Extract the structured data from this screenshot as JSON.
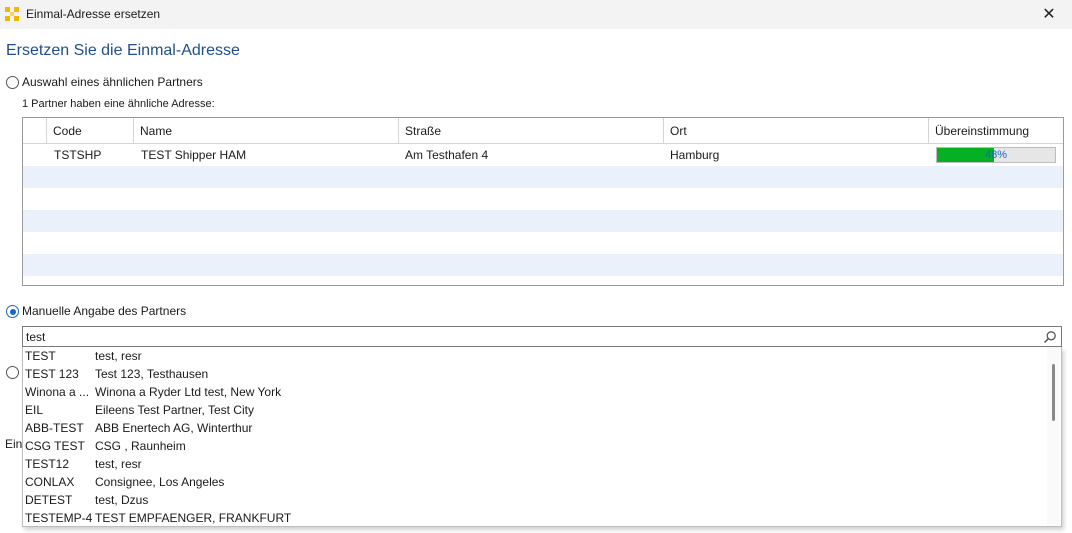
{
  "window": {
    "title": "Einmal-Adresse ersetzen",
    "close_glyph": "✕"
  },
  "heading": "Ersetzen Sie die Einmal-Adresse",
  "option_similar": {
    "label": "Auswahl eines ähnlichen Partners",
    "sub_label": "1 Partner haben eine ähnliche Adresse:",
    "columns": [
      "Code",
      "Name",
      "Straße",
      "Ort",
      "Übereinstimmung"
    ],
    "rows": [
      {
        "code": "TSTSHP",
        "name": "TEST Shipper HAM",
        "street": "Am Testhafen 4",
        "city": "Hamburg",
        "match_text": "48%",
        "match_value": 0.48
      }
    ]
  },
  "option_manual": {
    "label": "Manuelle Angabe des Partners",
    "search_value": "test",
    "search_icon": "magnifier-icon",
    "suggestions": [
      {
        "code": "TEST",
        "desc": "test, resr"
      },
      {
        "code": "TEST 123",
        "desc": "Test 123, Testhausen"
      },
      {
        "code": "Winona a ...",
        "desc": "Winona a Ryder Ltd test, New York"
      },
      {
        "code": "EIL",
        "desc": "Eileens Test Partner, Test City"
      },
      {
        "code": "ABB-TEST",
        "desc": "ABB Enertech AG, Winterthur"
      },
      {
        "code": "CSG TEST",
        "desc": "CSG , Raunheim"
      },
      {
        "code": "TEST12",
        "desc": "test, resr"
      },
      {
        "code": "CONLAX",
        "desc": "Consignee, Los Angeles"
      },
      {
        "code": "DETEST",
        "desc": "test, Dzus"
      },
      {
        "code": "TESTEMP-4",
        "desc": "TEST EMPFAENGER, FRANKFURT"
      }
    ]
  },
  "partial_text": "Ein",
  "colors": {
    "accent": "#1766c8",
    "heading": "#1f4e8c",
    "progress": "#06b025",
    "row_alt": "#eaf1fb"
  }
}
